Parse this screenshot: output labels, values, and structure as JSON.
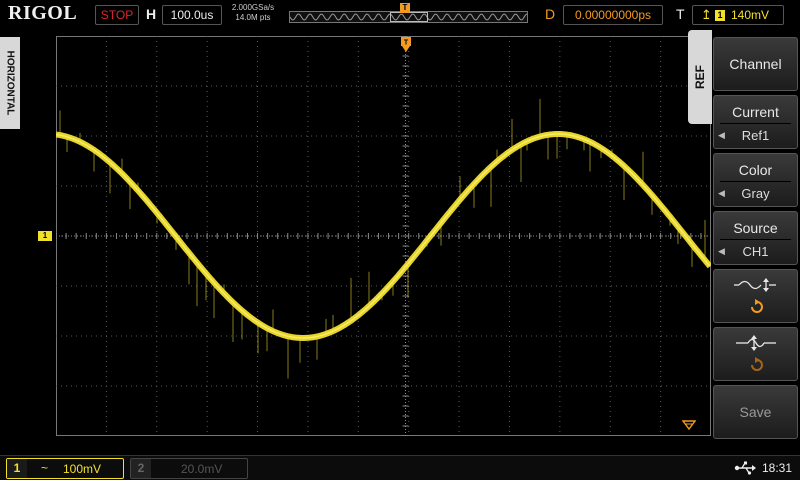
{
  "brand": "RIGOL",
  "run_state": "STOP",
  "horizontal": {
    "label": "H",
    "timebase": "100.0us",
    "sample_rate": "2.000GSa/s",
    "memory_depth": "14.0M pts",
    "delay_label": "D",
    "delay": "0.00000000ps",
    "tab_label": "HORIZONTAL"
  },
  "trigger": {
    "label": "T",
    "source": "1",
    "level": "140mV",
    "edge_icon": "rising-edge-icon",
    "position_marker": "T"
  },
  "menu": {
    "tab_label": "REF",
    "channel": {
      "label": "Channel"
    },
    "current": {
      "label": "Current",
      "value": "Ref1"
    },
    "color": {
      "label": "Color",
      "value": "Gray"
    },
    "source": {
      "label": "Source",
      "value": "CH1"
    },
    "save_to_ref": {
      "icon": "save-to-ref-icon"
    },
    "recall_ref": {
      "icon": "recall-ref-icon"
    },
    "save": {
      "label": "Save"
    }
  },
  "channels": [
    {
      "number": "1",
      "coupling_icon": "~",
      "scale": "100mV",
      "active": true
    },
    {
      "number": "2",
      "scale": "20.0mV",
      "active": false
    }
  ],
  "waveform": {
    "channel_marker": "1",
    "color": "#f2e02a"
  },
  "status": {
    "usb_icon": "usb-icon",
    "time": "18:31"
  },
  "colors": {
    "ch1": "#f2e02a",
    "trigger": "#f39a21",
    "stop": "#e0242a",
    "grid": "#5a5a5a"
  }
}
